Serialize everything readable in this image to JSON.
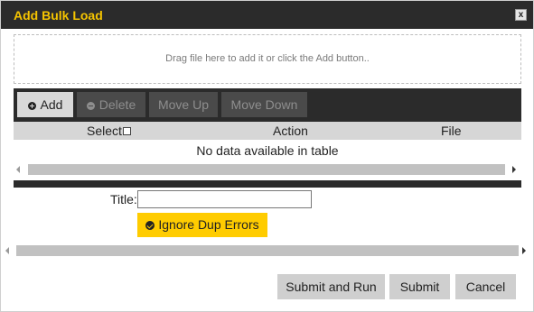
{
  "dialog": {
    "title": "Add Bulk Load",
    "close_label": "x"
  },
  "dropzone": {
    "text": "Drag file here to add it or click the Add button.."
  },
  "toolbar": {
    "add_label": "Add",
    "delete_label": "Delete",
    "move_up_label": "Move Up",
    "move_down_label": "Move Down"
  },
  "table": {
    "columns": [
      "Select",
      "Action",
      "File"
    ],
    "empty_message": "No data available in table"
  },
  "form": {
    "title_label": "Title:",
    "title_value": "",
    "ignore_dup_label": "Ignore Dup Errors"
  },
  "footer": {
    "submit_and_run_label": "Submit and Run",
    "submit_label": "Submit",
    "cancel_label": "Cancel"
  },
  "colors": {
    "title_text": "#f5c400",
    "accent_button": "#ffcc00",
    "toolbar_bg": "#2b2b2b"
  },
  "icons": {
    "add": "plus-circle-icon",
    "delete": "minus-circle-icon",
    "ignore_dup": "check-circle-icon",
    "close": "close-icon"
  }
}
